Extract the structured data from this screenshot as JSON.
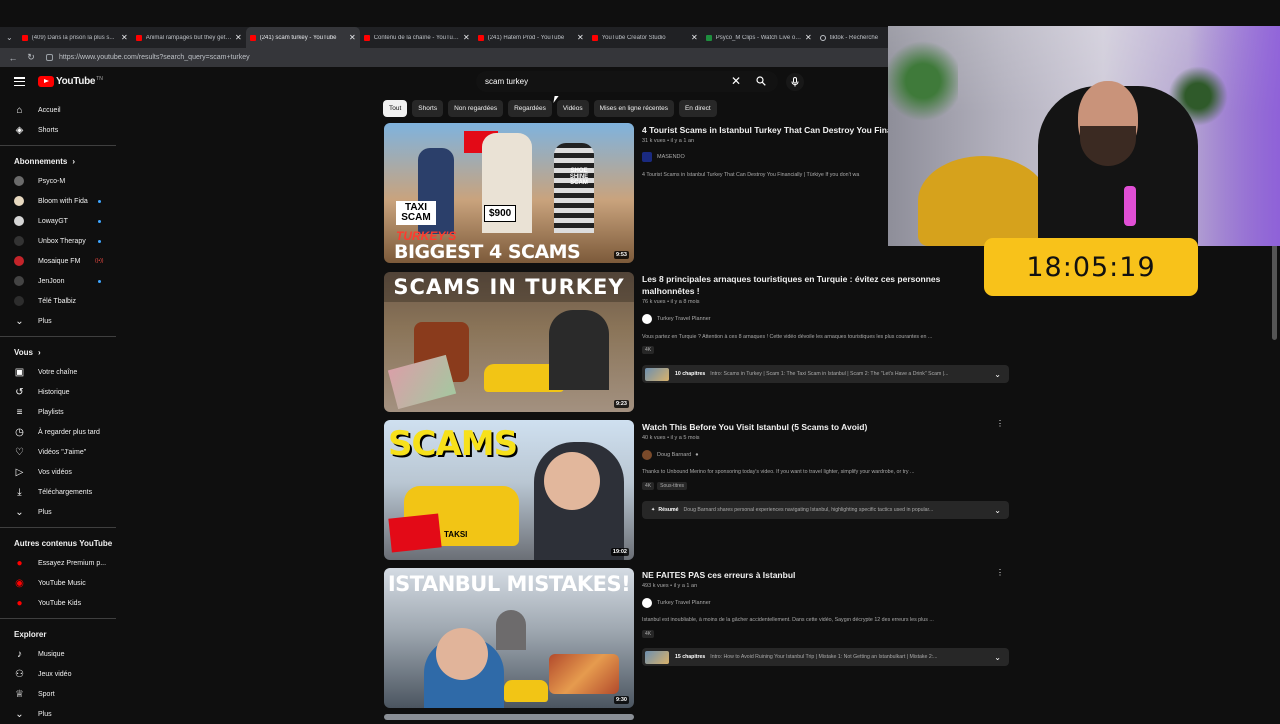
{
  "browser": {
    "tabs": [
      {
        "title": "(409) Dans la prison la plus s...",
        "favicon": "yt"
      },
      {
        "title": "Animal rampages but they get a...",
        "favicon": "yt"
      },
      {
        "title": "(241) scam turkey - YouTube",
        "favicon": "yt",
        "active": true
      },
      {
        "title": "Contenu de la chaîne - YouTube...",
        "favicon": "yt"
      },
      {
        "title": "(241) Hatem Prod - YouTube",
        "favicon": "yt"
      },
      {
        "title": "YouTube Creator Studio",
        "favicon": "yt"
      },
      {
        "title": "Psyco_M Clips - Watch Live on K...",
        "favicon": "green"
      },
      {
        "title": "tiktok - Recherche",
        "favicon": "search"
      }
    ],
    "url": "https://www.youtube.com/results?search_query=scam+turkey"
  },
  "header": {
    "logo_text": "YouTube",
    "logo_sup": "TN",
    "search_value": "scam turkey"
  },
  "sidebar": {
    "main": [
      {
        "label": "Accueil",
        "icon": "home-icon"
      },
      {
        "label": "Shorts",
        "icon": "shorts-icon"
      }
    ],
    "subs_title": "Abonnements",
    "subs": [
      {
        "label": "Psyco-M",
        "color": "#6b6b6b",
        "dot": false
      },
      {
        "label": "Bloom with Fida",
        "color": "#e8d9c0",
        "dot": true
      },
      {
        "label": "LowayGT",
        "color": "#d6d6d6",
        "dot": true
      },
      {
        "label": "Unbox Therapy",
        "color": "#333333",
        "dot": true
      },
      {
        "label": "Mosaique FM",
        "color": "#c4242a",
        "badge": "((•))"
      },
      {
        "label": "JenJoon",
        "color": "#444444",
        "dot": true
      },
      {
        "label": "Télé Tbalbiz",
        "color": "#2d2d2d",
        "dot": false
      }
    ],
    "subs_more": "Plus",
    "you_title": "Vous",
    "you": [
      {
        "label": "Votre chaîne",
        "icon": "user-box-icon"
      },
      {
        "label": "Historique",
        "icon": "history-icon"
      },
      {
        "label": "Playlists",
        "icon": "playlist-icon"
      },
      {
        "label": "À regarder plus tard",
        "icon": "clock-icon"
      },
      {
        "label": "Vidéos \"J'aime\"",
        "icon": "like-icon"
      },
      {
        "label": "Vos vidéos",
        "icon": "video-icon"
      },
      {
        "label": "Téléchargements",
        "icon": "download-icon"
      }
    ],
    "you_more": "Plus",
    "other_title": "Autres contenus YouTube",
    "other": [
      {
        "label": "Essayez Premium p...",
        "icon": "premium-icon"
      },
      {
        "label": "YouTube Music",
        "icon": "music-icon"
      },
      {
        "label": "YouTube Kids",
        "icon": "kids-icon"
      }
    ],
    "explore_title": "Explorer",
    "explore": [
      {
        "label": "Musique",
        "icon": "music-note-icon"
      },
      {
        "label": "Jeux vidéo",
        "icon": "gamepad-icon"
      },
      {
        "label": "Sport",
        "icon": "trophy-icon"
      }
    ],
    "explore_more": "Plus"
  },
  "chips": [
    "Tout",
    "Shorts",
    "Non regardées",
    "Regardées",
    "Vidéos",
    "Mises en ligne récentes",
    "En direct"
  ],
  "videos": [
    {
      "title": "4 Tourist Scams in Istanbul Turkey That Can Destroy You Finan...",
      "meta": "31 k vues • il y a 1 an",
      "channel": "MASENDO",
      "desc": "4 Tourist Scams in Istanbul Turkey That Can Destroy You Financially | Türkiye If you don't wa",
      "duration": "9:53",
      "thumb_text": "BIGGEST 4 SCAMS",
      "thumb_text2": "TURKEY'S",
      "thumb_text3": "TAXI SCAM",
      "thumb_text4": "$900",
      "thumb_text5": "SHOE SHINE SCAM"
    },
    {
      "title": "Les 8 principales arnaques touristiques en Turquie : évitez ces personnes malhonnêtes !",
      "meta": "76 k vues • il y a 8 mois",
      "channel": "Turkey Travel Planner",
      "desc": "Vous partez en Turquie ? Attention à ces 8 arnaques ! Cette vidéo dévoile les arnaques touristiques les plus courantes en ...",
      "badges": [
        "4K"
      ],
      "chapters_label": "10 chapitres",
      "chapters_text": "Intro: Scams in Turkey | Scam 1: The Taxi Scam in Istanbul | Scam 2: The \"Let's Have a Drink\" Scam |...",
      "duration": "9:23",
      "thumb_text": "SCAMS IN TURKEY"
    },
    {
      "title": "Watch This Before You Visit Istanbul (5 Scams to Avoid)",
      "meta": "40 k vues • il y a 5 mois",
      "channel": "Doug Barnard",
      "desc": "Thanks to Unbound Merino for sponsoring today's video. If you want to travel lighter, simplify your wardrobe, or try ...",
      "badges": [
        "4K",
        "Sous-titres"
      ],
      "summary_label": "Résumé",
      "summary_text": "Doug Barnard shares personal experiences navigating Istanbul, highlighting specific tactics used in popular...",
      "duration": "19:02",
      "thumb_text": "SCAMS",
      "thumb_text2": "TAKSI"
    },
    {
      "title": "NE FAITES PAS ces erreurs à Istanbul",
      "meta": "493 k vues • il y a 1 an",
      "channel": "Turkey Travel Planner",
      "desc": "Istanbul est inoubliable, à moins de la gâcher accidentellement. Dans cette vidéo, Saygın décrypte 12 des erreurs les plus ...",
      "badges": [
        "4K"
      ],
      "chapters_label": "15 chapitres",
      "chapters_text": "Intro: How to Avoid Ruining Your Istanbul Trip | Mistake 1: Not Getting an Istanbulkart | Mistake 2:...",
      "duration": "9:30",
      "thumb_text": "ISTANBUL MISTAKES!"
    }
  ],
  "overlay": {
    "clock": "18:05:19"
  },
  "colors": {
    "bg": "#0f0f0f",
    "yt_red": "#ff0000",
    "clock_bg": "#f8c21a",
    "chip_bg": "#272727"
  }
}
